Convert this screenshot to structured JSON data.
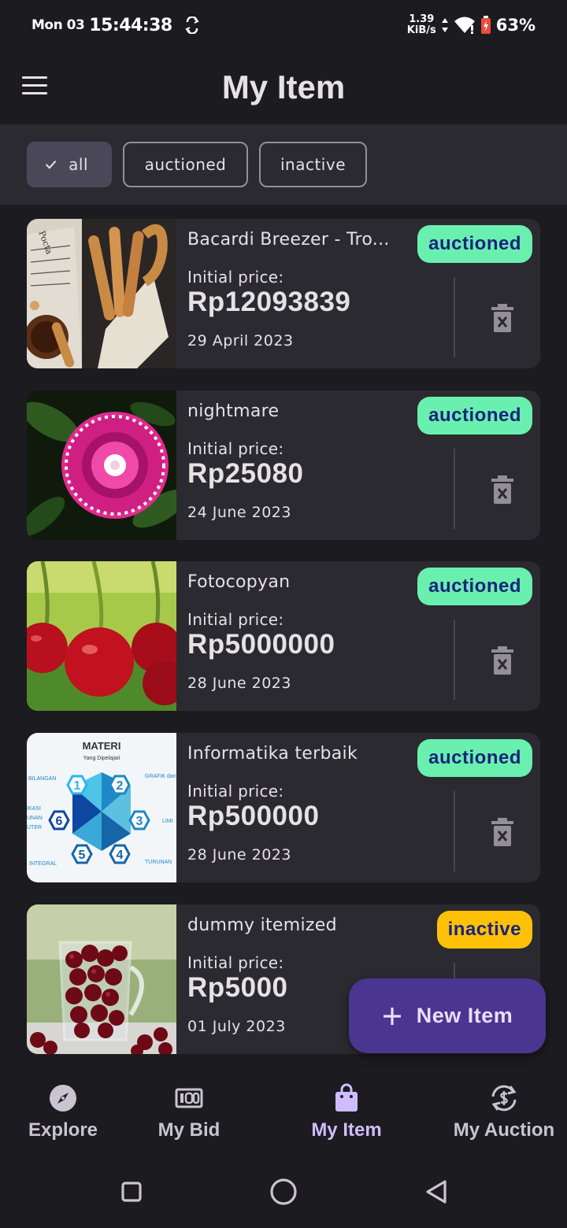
{
  "status_bar": {
    "day": "Mon 03",
    "time": "15:44:38",
    "net_speed_value": "1.39",
    "net_speed_unit": "KiB/s",
    "battery": "63%"
  },
  "app_bar": {
    "title": "My Item",
    "menu_icon": "hamburger-menu-icon"
  },
  "filters": [
    {
      "label": "all",
      "selected": true
    },
    {
      "label": "auctioned",
      "selected": false
    },
    {
      "label": "inactive",
      "selected": false
    }
  ],
  "items": [
    {
      "name": "Bacardi Breezer - Tro...",
      "price_label": "Initial price:",
      "price": "Rp12093839",
      "date": "29 April 2023",
      "status": "auctioned",
      "image": "churros-photo"
    },
    {
      "name": "nightmare",
      "price_label": "Initial price:",
      "price": "Rp25080",
      "date": "24 June 2023",
      "status": "auctioned",
      "image": "pink-flower-photo"
    },
    {
      "name": "Fotocopyan",
      "price_label": "Initial price:",
      "price": "Rp5000000",
      "date": "28 June 2023",
      "status": "auctioned",
      "image": "cherries-photo"
    },
    {
      "name": "Informatika terbaik",
      "price_label": "Initial price:",
      "price": "Rp500000",
      "date": "28 June 2023",
      "status": "auctioned",
      "image": "materi-diagram-image"
    },
    {
      "name": "dummy itemized",
      "price_label": "Initial price:",
      "price": "Rp5000",
      "date": "01 July 2023",
      "status": "inactive",
      "image": "cherries-glass-photo"
    }
  ],
  "thumb_text": {
    "materi_title": "MATERI",
    "materi_subtitle": "Yang Dipelajari",
    "materi_labels": [
      "BILANGAN",
      "GRAFIK dan",
      "IKASI",
      "UNAN",
      "UTER",
      "LIMI",
      "INTEGRAL",
      "TURUNAN"
    ],
    "materi_numbers": [
      "1",
      "2",
      "3",
      "4",
      "5",
      "6"
    ]
  },
  "fab": {
    "label": "New Item",
    "icon": "plus-icon"
  },
  "bottom_nav": [
    {
      "label": "Explore",
      "icon": "compass-icon",
      "active": false
    },
    {
      "label": "My Bid",
      "icon": "bid-icon",
      "active": false
    },
    {
      "label": "My Item",
      "icon": "shopping-bag-icon",
      "active": true
    },
    {
      "label": "My Auction",
      "icon": "auction-sync-icon",
      "active": false
    }
  ],
  "colors": {
    "background": "#1c1b1f",
    "card": "#2b2a30",
    "auctioned_badge": "#69f0ae",
    "inactive_badge": "#ffc107",
    "badge_text": "#1a237e",
    "fab": "#4a3591",
    "active_nav": "#cfbcff"
  }
}
